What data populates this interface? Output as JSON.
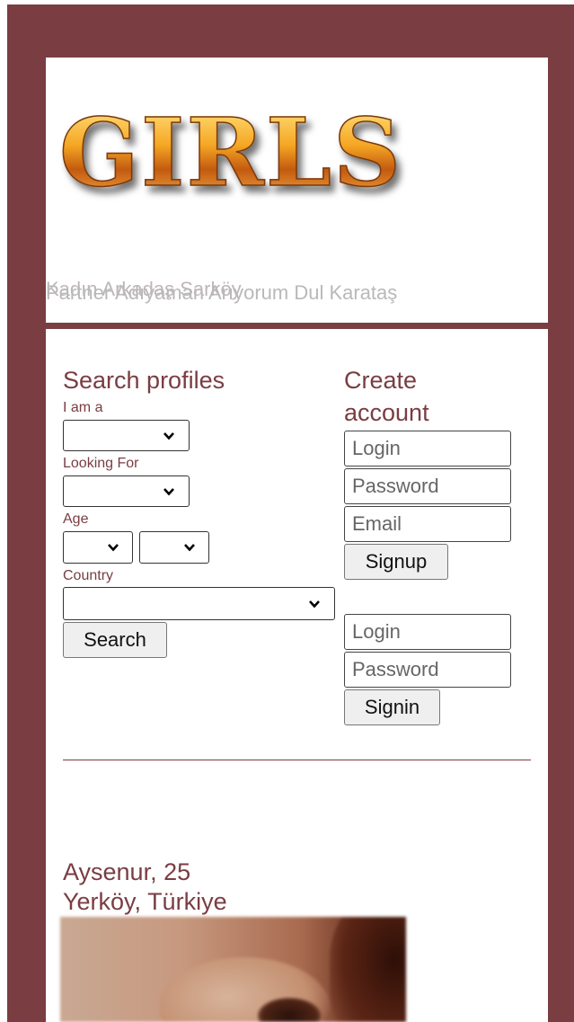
{
  "header": {
    "logo_text": "GIRLS",
    "marquee": [
      "Kadın Arkadaş Sarköy",
      "Partner Adıyaman Arıyorum Dul Karataş"
    ]
  },
  "search": {
    "title": "Search profiles",
    "iam_label": "I am a",
    "iam_value": "",
    "looking_label": "Looking For",
    "looking_value": "",
    "age_label": "Age",
    "age_from_value": "",
    "age_to_value": "",
    "country_label": "Country",
    "country_value": "",
    "search_button": "Search"
  },
  "signup": {
    "title_line1": "Create",
    "title_line2": "account",
    "login_placeholder": "Login",
    "password_placeholder": "Password",
    "email_placeholder": "Email",
    "signup_button": "Signup"
  },
  "signin": {
    "login_placeholder": "Login",
    "password_placeholder": "Password",
    "signin_button": "Signin"
  },
  "profile": {
    "name_age": "Aysenur, 25",
    "location": "Yerköy, Türkiye"
  },
  "colors": {
    "accent": "#7a3d42",
    "background": "#ffffff"
  },
  "icons": {
    "select_arrow": "chevron-down-icon"
  }
}
